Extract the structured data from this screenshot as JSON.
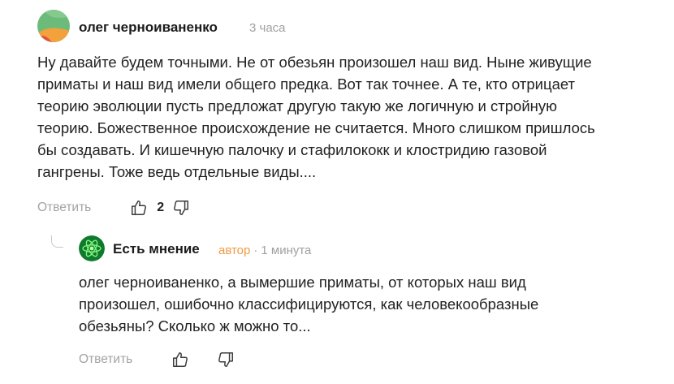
{
  "comments": [
    {
      "author": "олег черноиваненко",
      "time": "3 часа",
      "avatar_colors": [
        "#6dbb7a",
        "#f2a13c",
        "#e0553f"
      ],
      "lines": [
        "Ну давайте будем точными. Не от обезьян произошел наш вид. Ныне живущие",
        "приматы и наш вид имели общего предка. Вот так точнее. А те, кто отрицает",
        "теорию эволюции пусть предложат другую такую же логичную и стройную",
        "теорию. Божественное происхождение не считается. Много слишком пришлось",
        "бы создавать. И кишечную палочку и стафилококк и клостридию газовой",
        "гангрены. Тоже ведь отдельные виды...."
      ],
      "reply_label": "Ответить",
      "like_icon": "thumbs-up-icon",
      "likes": "2",
      "dislike_icon": "thumbs-down-icon"
    },
    {
      "author": "Есть мнение",
      "badge": "автор",
      "separator": "·",
      "time": "1 минута",
      "avatar_icon": "atom-icon",
      "avatar_colors": [
        "#0f7a2e",
        "#7ff27a"
      ],
      "lines": [
        "олег черноиваненко, а вымершие приматы, от которых наш вид",
        "произошел, ошибочно классифицируются, как человекообразные",
        "обезьяны? Сколько ж можно то..."
      ],
      "reply_label": "Ответить",
      "like_icon": "thumbs-up-icon",
      "dislike_icon": "thumbs-down-icon"
    }
  ],
  "colors": {
    "meta": "#a0a0a0",
    "author_badge": "#ef9b42",
    "text": "#222222"
  }
}
